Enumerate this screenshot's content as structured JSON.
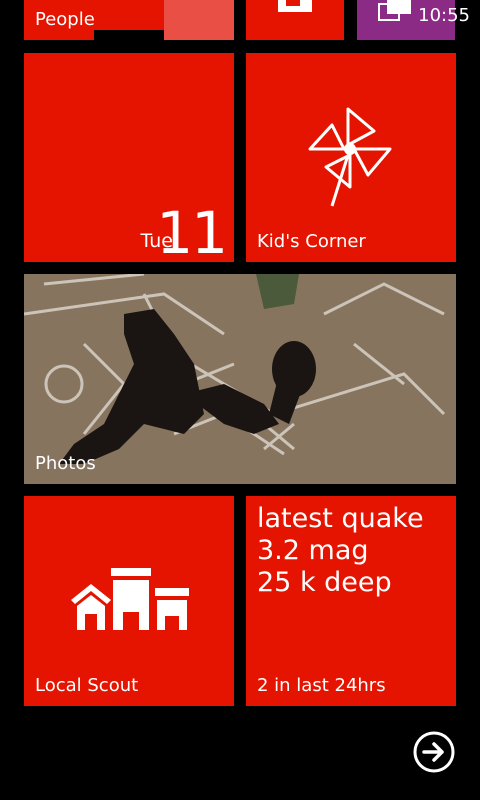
{
  "status": {
    "time": "10:55"
  },
  "tiles": {
    "people": {
      "label": "People"
    },
    "office": {
      "icon": "office-icon"
    },
    "store": {
      "icon": "store-icon"
    },
    "calendar": {
      "day": "Tue",
      "date": "11"
    },
    "kids_corner": {
      "label": "Kid's Corner",
      "icon": "pinwheel-icon"
    },
    "photos": {
      "label": "Photos"
    },
    "local_scout": {
      "label": "Local Scout",
      "icon": "buildings-icon"
    },
    "quake": {
      "line1": "latest quake",
      "line2": "3.2 mag",
      "line3": "25 k deep",
      "label": "2 in last 24hrs"
    }
  },
  "nav": {
    "all_apps_icon": "arrow-right-circle-icon"
  },
  "colors": {
    "accent": "#e51400",
    "background": "#000000",
    "store": "#8b2b86"
  }
}
